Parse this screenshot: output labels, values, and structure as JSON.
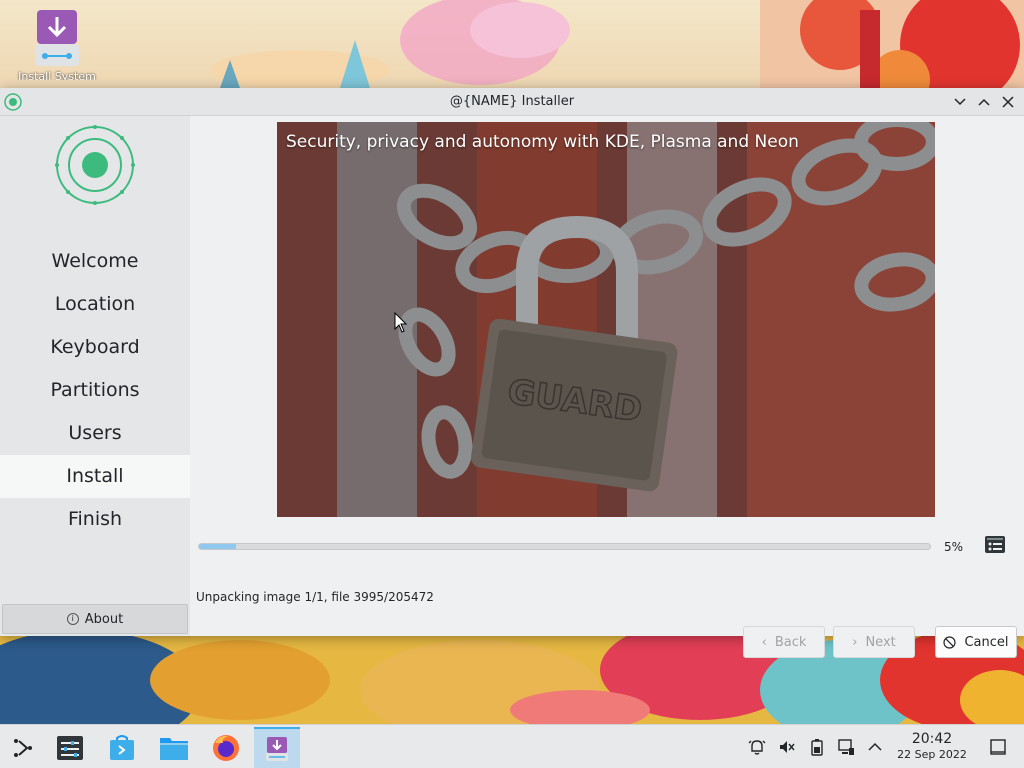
{
  "desktop": {
    "icon_label": "Install System"
  },
  "window": {
    "title": "@{NAME} Installer",
    "controls": [
      "minimize-icon",
      "maximize-icon",
      "close-icon"
    ]
  },
  "sidebar": {
    "steps": [
      {
        "label": "Welcome"
      },
      {
        "label": "Location"
      },
      {
        "label": "Keyboard"
      },
      {
        "label": "Partitions"
      },
      {
        "label": "Users"
      },
      {
        "label": "Install",
        "active": true
      },
      {
        "label": "Finish"
      }
    ],
    "about_label": "About"
  },
  "slide": {
    "caption": "Security, privacy and autonomy with KDE, Plasma and Neon",
    "padlock_text": "GUARD"
  },
  "progress": {
    "percent_label": "5%",
    "value": 0.05
  },
  "status_text": "Unpacking image 1/1, file 3995/205472",
  "buttons": {
    "back": "Back",
    "next": "Next",
    "cancel": "Cancel"
  },
  "taskbar": {
    "apps": [
      "application-launcher-icon",
      "system-settings-icon",
      "discover-icon",
      "file-manager-icon",
      "firefox-icon",
      "installer-icon"
    ],
    "tray": [
      "notifications-icon",
      "volume-muted-icon",
      "battery-icon",
      "network-icon",
      "expand-tray-icon"
    ],
    "time": "20:42",
    "date": "22 Sep 2022"
  },
  "colors": {
    "accent": "#3daee9",
    "logo_green": "#3dbb7e",
    "progress_fill": "#8fc9ef"
  }
}
